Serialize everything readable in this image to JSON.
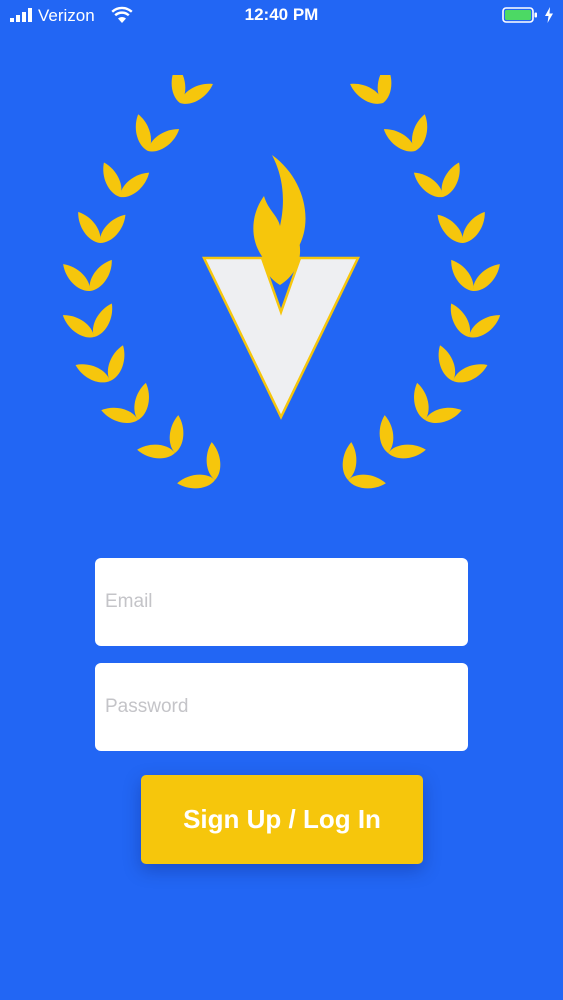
{
  "status_bar": {
    "carrier": "Verizon",
    "time": "12:40 PM"
  },
  "icons": {
    "signal": "cellular-signal-icon",
    "wifi": "wifi-icon",
    "battery": "battery-icon",
    "charging": "charging-bolt-icon",
    "logo": "laurel-torch-v-logo"
  },
  "colors": {
    "background": "#2266f4",
    "accent_gold": "#f6c60c",
    "logo_letter": "#eeeff2",
    "battery_level": "#4cd964"
  },
  "form": {
    "email_placeholder": "Email",
    "password_placeholder": "Password",
    "submit_label": "Sign Up / Log In"
  }
}
